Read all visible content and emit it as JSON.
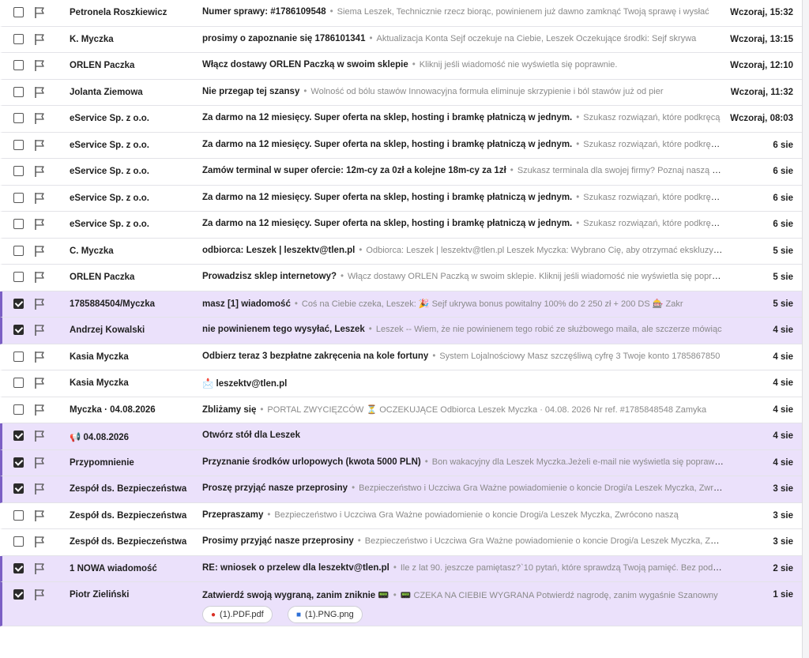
{
  "emails": [
    {
      "sender": "Petronela Roszkiewicz",
      "subject": "Numer sprawy: #1786109548",
      "preview": "Siema Leszek, Technicznie rzecz biorąc, powinienem już dawno zamknąć Twoją sprawę i wysłać",
      "date": "Wczoraj, 15:32",
      "selected": false
    },
    {
      "sender": "K. Myczka",
      "subject": "prosimy o zapoznanie się 1786101341",
      "preview": "Aktualizacja Konta Sejf oczekuje na Ciebie, Leszek Oczekujące środki: Sejf skrywa",
      "date": "Wczoraj, 13:15",
      "selected": false
    },
    {
      "sender": "ORLEN Paczka",
      "subject": "Włącz dostawy ORLEN Paczką w swoim sklepie",
      "preview": "Kliknij jeśli wiadomość nie wyświetla się poprawnie.",
      "date": "Wczoraj, 12:10",
      "selected": false
    },
    {
      "sender": "Jolanta Ziemowa",
      "subject": "Nie przegap tej szansy",
      "preview": "Wolność od bólu stawów   Innowacyjna formuła eliminuje skrzypienie i ból stawów już od pier",
      "date": "Wczoraj, 11:32",
      "selected": false
    },
    {
      "sender": "eService Sp. z o.o.",
      "subject": "Za darmo na 12 miesięcy. Super oferta na sklep, hosting i bramkę płatniczą w jednym.",
      "preview": "Szukasz rozwiązań, które podkręcą",
      "date": "Wczoraj, 08:03",
      "selected": false
    },
    {
      "sender": "eService Sp. z o.o.",
      "subject": "Za darmo na 12 miesięcy. Super oferta na sklep, hosting i bramkę płatniczą w jednym.",
      "preview": "Szukasz rozwiązań, które podkręcą Twój biznes",
      "date": "6 sie",
      "selected": false
    },
    {
      "sender": "eService Sp. z o.o.",
      "subject": "Zamów terminal w super ofercie: 12m-cy za 0zł a kolejne 18m-cy za 1zł",
      "preview": "Szukasz terminala dla swojej firmy? Poznaj naszą ofertę",
      "date": "6 sie",
      "selected": false
    },
    {
      "sender": "eService Sp. z o.o.",
      "subject": "Za darmo na 12 miesięcy. Super oferta na sklep, hosting i bramkę płatniczą w jednym.",
      "preview": "Szukasz rozwiązań, które podkręcą Twój biznes",
      "date": "6 sie",
      "selected": false
    },
    {
      "sender": "eService Sp. z o.o.",
      "subject": "Za darmo na 12 miesięcy. Super oferta na sklep, hosting i bramkę płatniczą w jednym.",
      "preview": "Szukasz rozwiązań, które podkręcą Twój biznes",
      "date": "6 sie",
      "selected": false
    },
    {
      "sender": "C. Myczka",
      "subject": "odbiorca: Leszek | leszektv@tlen.pl",
      "preview": "Odbiorca: Leszek | leszektv@tlen.pl Leszek Myczka: Wybrano Cię, aby otrzymać ekskluzywną",
      "date": "5 sie",
      "selected": false
    },
    {
      "sender": "ORLEN Paczka",
      "subject": "Prowadzisz sklep internetowy?",
      "preview": "Włącz dostawy ORLEN Paczką w swoim sklepie. Kliknij jeśli wiadomość nie wyświetla się poprawnie.",
      "date": "5 sie",
      "selected": false
    },
    {
      "sender": "1785884504/Myczka",
      "subject": "masz [1] wiadomość",
      "preview": "Coś na Ciebie czeka, Leszek: 🎉 Sejf ukrywa bonus powitalny 100% do 2 250 zł + 200 DS 🎰 Zakr",
      "date": "5 sie",
      "selected": true
    },
    {
      "sender": "Andrzej Kowalski",
      "subject": "nie powinienem tego wysyłać, Leszek",
      "preview": "Leszek -- Wiem, że nie powinienem tego robić ze służbowego maila, ale szczerze mówiąc",
      "date": "4 sie",
      "selected": true
    },
    {
      "sender": "Kasia Myczka",
      "subject": "Odbierz teraz 3 bezpłatne zakręcenia na kole fortuny",
      "preview": "System Lojalnościowy Masz szczęśliwą cyfrę 3 Twoje konto 1785867850",
      "date": "4 sie",
      "selected": false
    },
    {
      "sender": "Kasia Myczka",
      "subject": "📩 leszektv@tlen.pl",
      "preview": "",
      "date": "4 sie",
      "selected": false
    },
    {
      "sender": "Myczka · 04.08.2026",
      "subject": "Zbliżamy się",
      "preview": "PORTAL ZWYCIĘZCÓW ⏳ OCZEKUJĄCE Odbiorca Leszek Myczka · 04.08. 2026 Nr ref. #1785848548 Zamyka",
      "date": "4 sie",
      "selected": false
    },
    {
      "sender": "📢 04.08.2026",
      "subject": "Otwórz stół dla Leszek",
      "preview": "",
      "date": "4 sie",
      "selected": true
    },
    {
      "sender": "Przypomnienie",
      "subject": "Przyznanie środków urlopowych (kwota 5000 PLN)",
      "preview": "Bon wakacyjny dla Leszek Myczka.Jeżeli e-mail nie wyświetla się poprawnie",
      "date": "4 sie",
      "selected": true
    },
    {
      "sender": "Zespół ds. Bezpieczeństwa",
      "subject": "Proszę przyjąć nasze przeprosiny",
      "preview": "Bezpieczeństwo i Uczciwa Gra Ważne powiadomienie o koncie Drogi/a Leszek Myczka, Zwrócono",
      "date": "3 sie",
      "selected": true
    },
    {
      "sender": "Zespół ds. Bezpieczeństwa",
      "subject": "Przepraszamy",
      "preview": "Bezpieczeństwo i Uczciwa Gra Ważne powiadomienie o koncie Drogi/a Leszek Myczka, Zwrócono naszą",
      "date": "3 sie",
      "selected": false
    },
    {
      "sender": "Zespół ds. Bezpieczeństwa",
      "subject": "Prosimy przyjąć nasze przeprosiny",
      "preview": "Bezpieczeństwo i Uczciwa Gra Ważne powiadomienie o koncie Drogi/a Leszek Myczka, Zwrócono",
      "date": "3 sie",
      "selected": false
    },
    {
      "sender": "1 NOWA wiadomość",
      "subject": "RE: wniosek o przelew dla leszektv@tlen.pl",
      "preview": "Ile z lat 90. jeszcze pamiętasz?`10 pytań, które sprawdzą Twoją pamięć. Bez podglądania",
      "date": "2 sie",
      "selected": true
    },
    {
      "sender": "Piotr Zieliński",
      "subject": "Zatwierdź swoją wygraną, zanim zniknie 📟",
      "preview": "📟 CZEKA NA CIEBIE WYGRANA Potwierdź nagrodę, zanim wygaśnie Szanowny",
      "date": "1 sie",
      "selected": true,
      "attachments": [
        {
          "name": "(1).PDF.pdf",
          "icon": "pdf-icon"
        },
        {
          "name": "(1).PNG.png",
          "icon": "png-icon"
        }
      ]
    }
  ],
  "colors": {
    "selected_bg": "#ebe1fb",
    "selected_bar": "#7b5fc4",
    "border": "#e3e3e8"
  }
}
